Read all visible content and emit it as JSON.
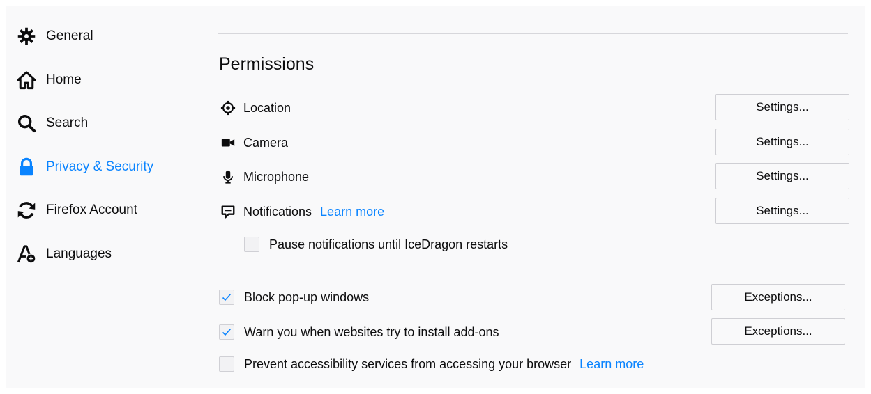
{
  "sidebar": {
    "items": [
      {
        "label": "General",
        "icon": "gear-icon"
      },
      {
        "label": "Home",
        "icon": "home-icon"
      },
      {
        "label": "Search",
        "icon": "search-icon"
      },
      {
        "label": "Privacy & Security",
        "icon": "lock-icon",
        "active": true
      },
      {
        "label": "Firefox Account",
        "icon": "sync-icon"
      },
      {
        "label": "Languages",
        "icon": "language-icon"
      }
    ]
  },
  "permissions": {
    "title": "Permissions",
    "rows": [
      {
        "label": "Location",
        "icon": "location-icon",
        "button": "Settings..."
      },
      {
        "label": "Camera",
        "icon": "camera-icon",
        "button": "Settings..."
      },
      {
        "label": "Microphone",
        "icon": "microphone-icon",
        "button": "Settings..."
      },
      {
        "label": "Notifications",
        "icon": "notification-icon",
        "link": "Learn more",
        "button": "Settings..."
      }
    ],
    "pause_notifications": {
      "label": "Pause notifications until IceDragon restarts",
      "checked": false
    },
    "block_popups": {
      "label": "Block pop-up windows",
      "checked": true,
      "button": "Exceptions..."
    },
    "warn_addons": {
      "label": "Warn you when websites try to install add-ons",
      "checked": true,
      "button": "Exceptions..."
    },
    "prevent_accessibility": {
      "label": "Prevent accessibility services from accessing your browser",
      "checked": false,
      "link": "Learn more"
    }
  },
  "colors": {
    "accent": "#0a84ff",
    "text": "#0c0c0d",
    "background": "#f9f9fa"
  }
}
